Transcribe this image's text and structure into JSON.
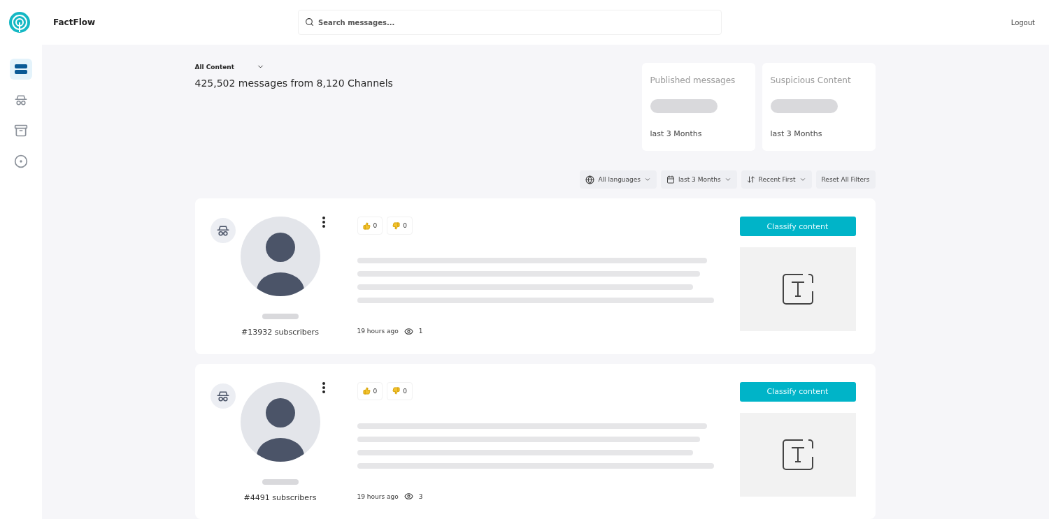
{
  "header": {
    "brand": "FactFlow",
    "search": {
      "placeholder": "Search messages..."
    },
    "logout": "Logout"
  },
  "sidebar": {
    "items": [
      {
        "selected": true
      },
      {
        "selected": false
      },
      {
        "selected": false
      },
      {
        "selected": false
      }
    ]
  },
  "content_filter": {
    "value": "All Content"
  },
  "summary": "425,502 messages from 8,120 Channels",
  "stats": [
    {
      "title": "Published messages",
      "period": "last 3 Months"
    },
    {
      "title": "Suspicious Content",
      "period": "last 3 Months"
    }
  ],
  "filters": [
    {
      "kind": "language",
      "label": "All languages"
    },
    {
      "kind": "date",
      "label": "last 3 Months"
    },
    {
      "kind": "sort",
      "label": "Recent First"
    }
  ],
  "reset": "Reset All Filters",
  "posts": [
    {
      "subscribers": "#13932 subscribers",
      "likes": "0",
      "dislikes": "0",
      "time": "19 hours ago",
      "views": "1",
      "action": "Classify content"
    },
    {
      "subscribers": "#4491 subscribers",
      "likes": "0",
      "dislikes": "0",
      "time": "19 hours ago",
      "views": "3",
      "action": "Classify content"
    }
  ]
}
